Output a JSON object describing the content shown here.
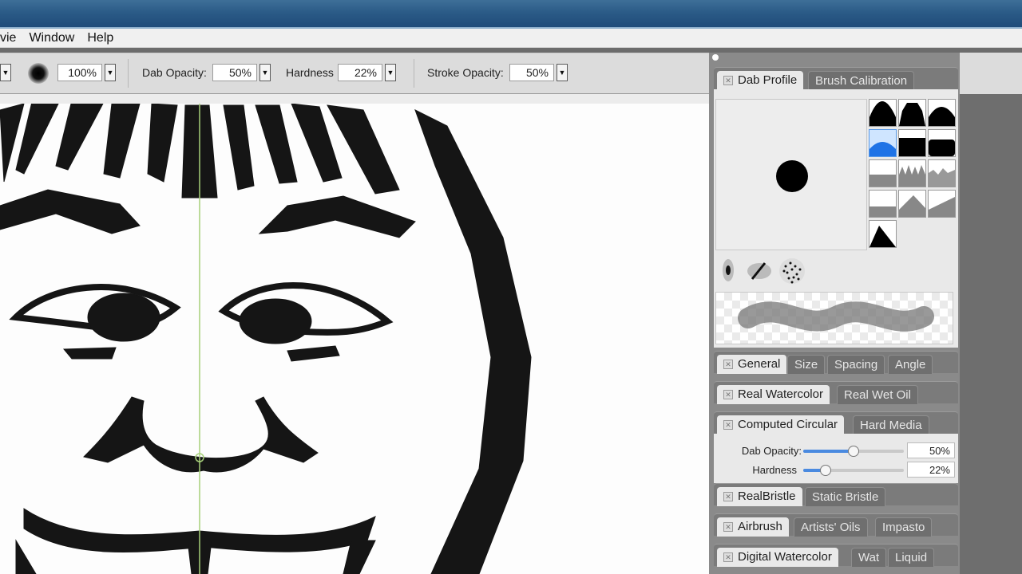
{
  "menu": [
    "vie",
    "Window",
    "Help"
  ],
  "toolbar": {
    "size_value": "100%",
    "dab_opacity_label": "Dab Opacity:",
    "dab_opacity_value": "50%",
    "hardness_label": "Hardness",
    "hardness_value": "22%",
    "stroke_opacity_label": "Stroke Opacity:",
    "stroke_opacity_value": "50%"
  },
  "panels": {
    "dab_profile": {
      "tabs": [
        "Dab Profile",
        "Brush Calibration"
      ],
      "active": "Dab Profile"
    },
    "general": {
      "tabs": [
        "General",
        "Size",
        "Spacing",
        "Angle"
      ],
      "active": "General"
    },
    "real_watercolor": {
      "tabs": [
        "Real Watercolor",
        "Real Wet Oil"
      ],
      "active": "Real Watercolor"
    },
    "computed_circular": {
      "tabs": [
        "Computed Circular",
        "Hard Media"
      ],
      "active": "Computed Circular",
      "sliders": [
        {
          "label": "Dab Opacity:",
          "value": "50%",
          "level": 0.5
        },
        {
          "label": "Hardness",
          "value": "22%",
          "level": 0.22
        }
      ]
    },
    "realbristle": {
      "tabs": [
        "RealBristle",
        "Static Bristle"
      ],
      "active": "RealBristle"
    },
    "airbrush": {
      "tabs": [
        "Airbrush",
        "Artists' Oils",
        "Impasto"
      ],
      "active": "Airbrush"
    },
    "digital_watercolor": {
      "tabs": [
        "Digital Watercolor",
        "Wat",
        "Liquid"
      ],
      "active": "Digital Watercolor"
    }
  },
  "icons": {
    "close": "close-icon",
    "dropdown": "dropdown-arrow-icon",
    "brush_preview": "brush-dab-preview-icon"
  },
  "colors": {
    "accent": "#4a8ae0",
    "title_bar": "#2a5a86",
    "guide_line": "#a7d07a"
  }
}
